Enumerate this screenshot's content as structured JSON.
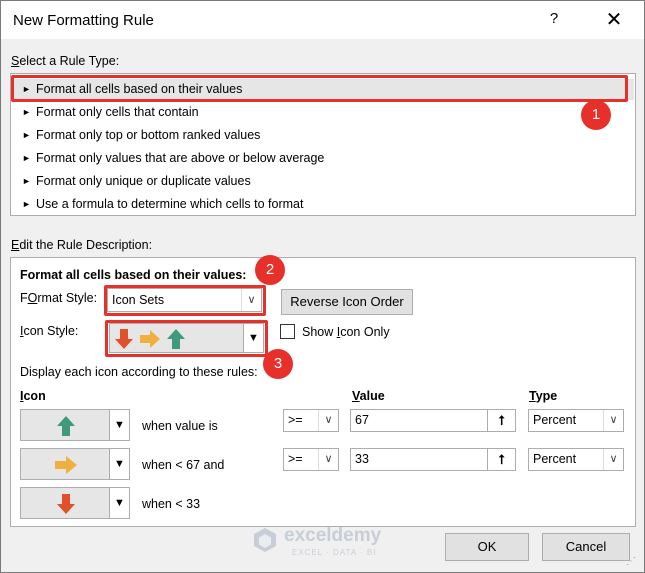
{
  "window": {
    "title": "New Formatting Rule",
    "help_label": "?",
    "close_label": "✕"
  },
  "rule_type": {
    "label_prefix": "",
    "label_u": "S",
    "label_rest": "elect a Rule Type:",
    "items": [
      "Format all cells based on their values",
      "Format only cells that contain",
      "Format only top or bottom ranked values",
      "Format only values that are above or below average",
      "Format only unique or duplicate values",
      "Use a formula to determine which cells to format"
    ],
    "selected_index": 0
  },
  "description": {
    "label_u": "E",
    "label_rest": "dit the Rule Description:",
    "heading": "Format all cells based on their values:",
    "format_style_label_u": "O",
    "format_style_label_pre": "F",
    "format_style_label_post": "rmat Style:",
    "format_style_value": "Icon Sets",
    "reverse_button": "Reverse Icon Order",
    "icon_style_label_pre": "",
    "icon_style_label_u": "I",
    "icon_style_label_post": "con Style:",
    "show_icon_only_pre": "Show ",
    "show_icon_only_u": "I",
    "show_icon_only_post": "con Only",
    "show_icon_only_checked": false,
    "rules_caption": "Display each icon according to these rules:",
    "col_icon_u": "I",
    "col_icon_rest": "con",
    "col_value_u": "V",
    "col_value_rest": "alue",
    "col_type_u": "T",
    "col_type_rest": "ype",
    "rows": [
      {
        "icon": "green-up-arrow-icon",
        "condition": "when value is",
        "operator": ">=",
        "value": "67",
        "type": "Percent"
      },
      {
        "icon": "yellow-right-arrow-icon",
        "condition": "when < 67 and",
        "operator": ">=",
        "value": "33",
        "type": "Percent"
      },
      {
        "icon": "red-down-arrow-icon",
        "condition": "when < 33"
      }
    ]
  },
  "buttons": {
    "ok": "OK",
    "cancel": "Cancel"
  },
  "badges": [
    "1",
    "2",
    "3"
  ],
  "watermark": {
    "name": "exceldemy",
    "tagline": "EXCEL · DATA · BI"
  },
  "colors": {
    "highlight_red": "#e8302a",
    "arrow_green": "#3f9a7a",
    "arrow_yellow": "#f0b040",
    "arrow_red": "#e0502a"
  }
}
